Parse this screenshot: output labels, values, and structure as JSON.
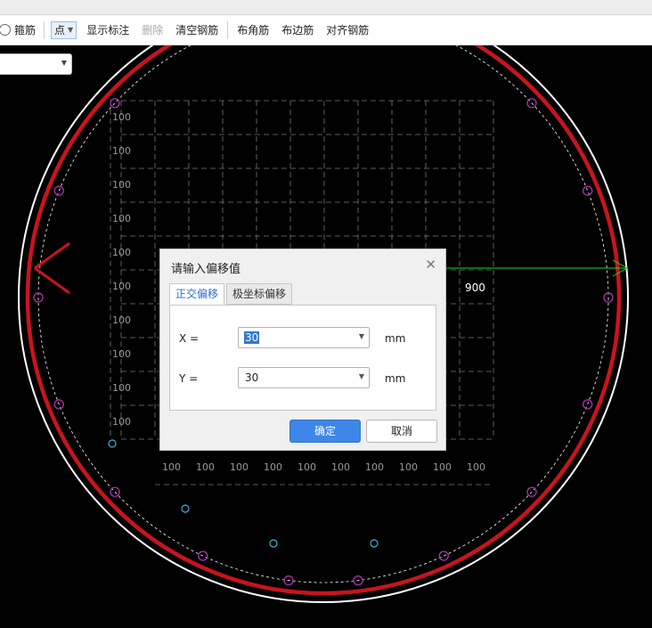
{
  "toolbar": {
    "stirrup_label": "箍筋",
    "point_label": "点",
    "show_annotation": "显示标注",
    "delete": "删除",
    "clear_rebar": "清空钢筋",
    "corner_rebar": "布角筋",
    "edge_rebar": "布边筋",
    "align_rebar": "对齐钢筋"
  },
  "left_combo": {
    "value": ""
  },
  "canvas": {
    "grid_label": "100",
    "dimension_label": "900",
    "colors": {
      "ring": "#c8141e",
      "outer_ring": "#ffffff",
      "rebar": "#b030b0",
      "point": "#40b0d8",
      "grid": "#7a7a7a",
      "dimension": "#1ed81e"
    }
  },
  "dialog": {
    "title": "请输入偏移值",
    "close_icon": "close-icon",
    "tabs": [
      {
        "label": "正交偏移",
        "active": true
      },
      {
        "label": "极坐标偏移",
        "active": false
      }
    ],
    "x_label": "X =",
    "x_value": "30",
    "y_label": "Y =",
    "y_value": "30",
    "unit": "mm",
    "ok_label": "确定",
    "cancel_label": "取消"
  }
}
